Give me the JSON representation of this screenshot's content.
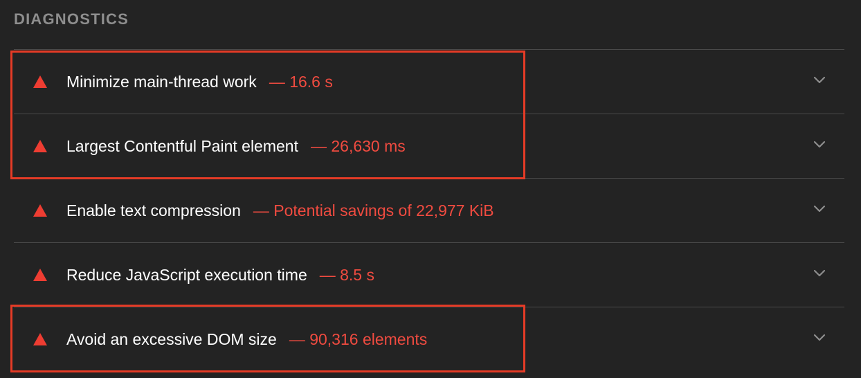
{
  "section": {
    "title": "DIAGNOSTICS"
  },
  "colors": {
    "background": "#232323",
    "title_gray": "#8e8e8e",
    "warning_red": "#ee3d32",
    "value_red": "#f04b40",
    "highlight_border": "#e53b26",
    "divider": "#4a4a4a"
  },
  "audits": [
    {
      "title": "Minimize main-thread work",
      "value": "— 16.6 s",
      "icon": "warning-triangle-icon",
      "highlighted": true
    },
    {
      "title": "Largest Contentful Paint element",
      "value": "— 26,630 ms",
      "icon": "warning-triangle-icon",
      "highlighted": true
    },
    {
      "title": "Enable text compression",
      "value": "— Potential savings of 22,977 KiB",
      "icon": "warning-triangle-icon",
      "highlighted": false
    },
    {
      "title": "Reduce JavaScript execution time",
      "value": "— 8.5 s",
      "icon": "warning-triangle-icon",
      "highlighted": false
    },
    {
      "title": "Avoid an excessive DOM size",
      "value": "— 90,316 elements",
      "icon": "warning-triangle-icon",
      "highlighted": true
    }
  ]
}
